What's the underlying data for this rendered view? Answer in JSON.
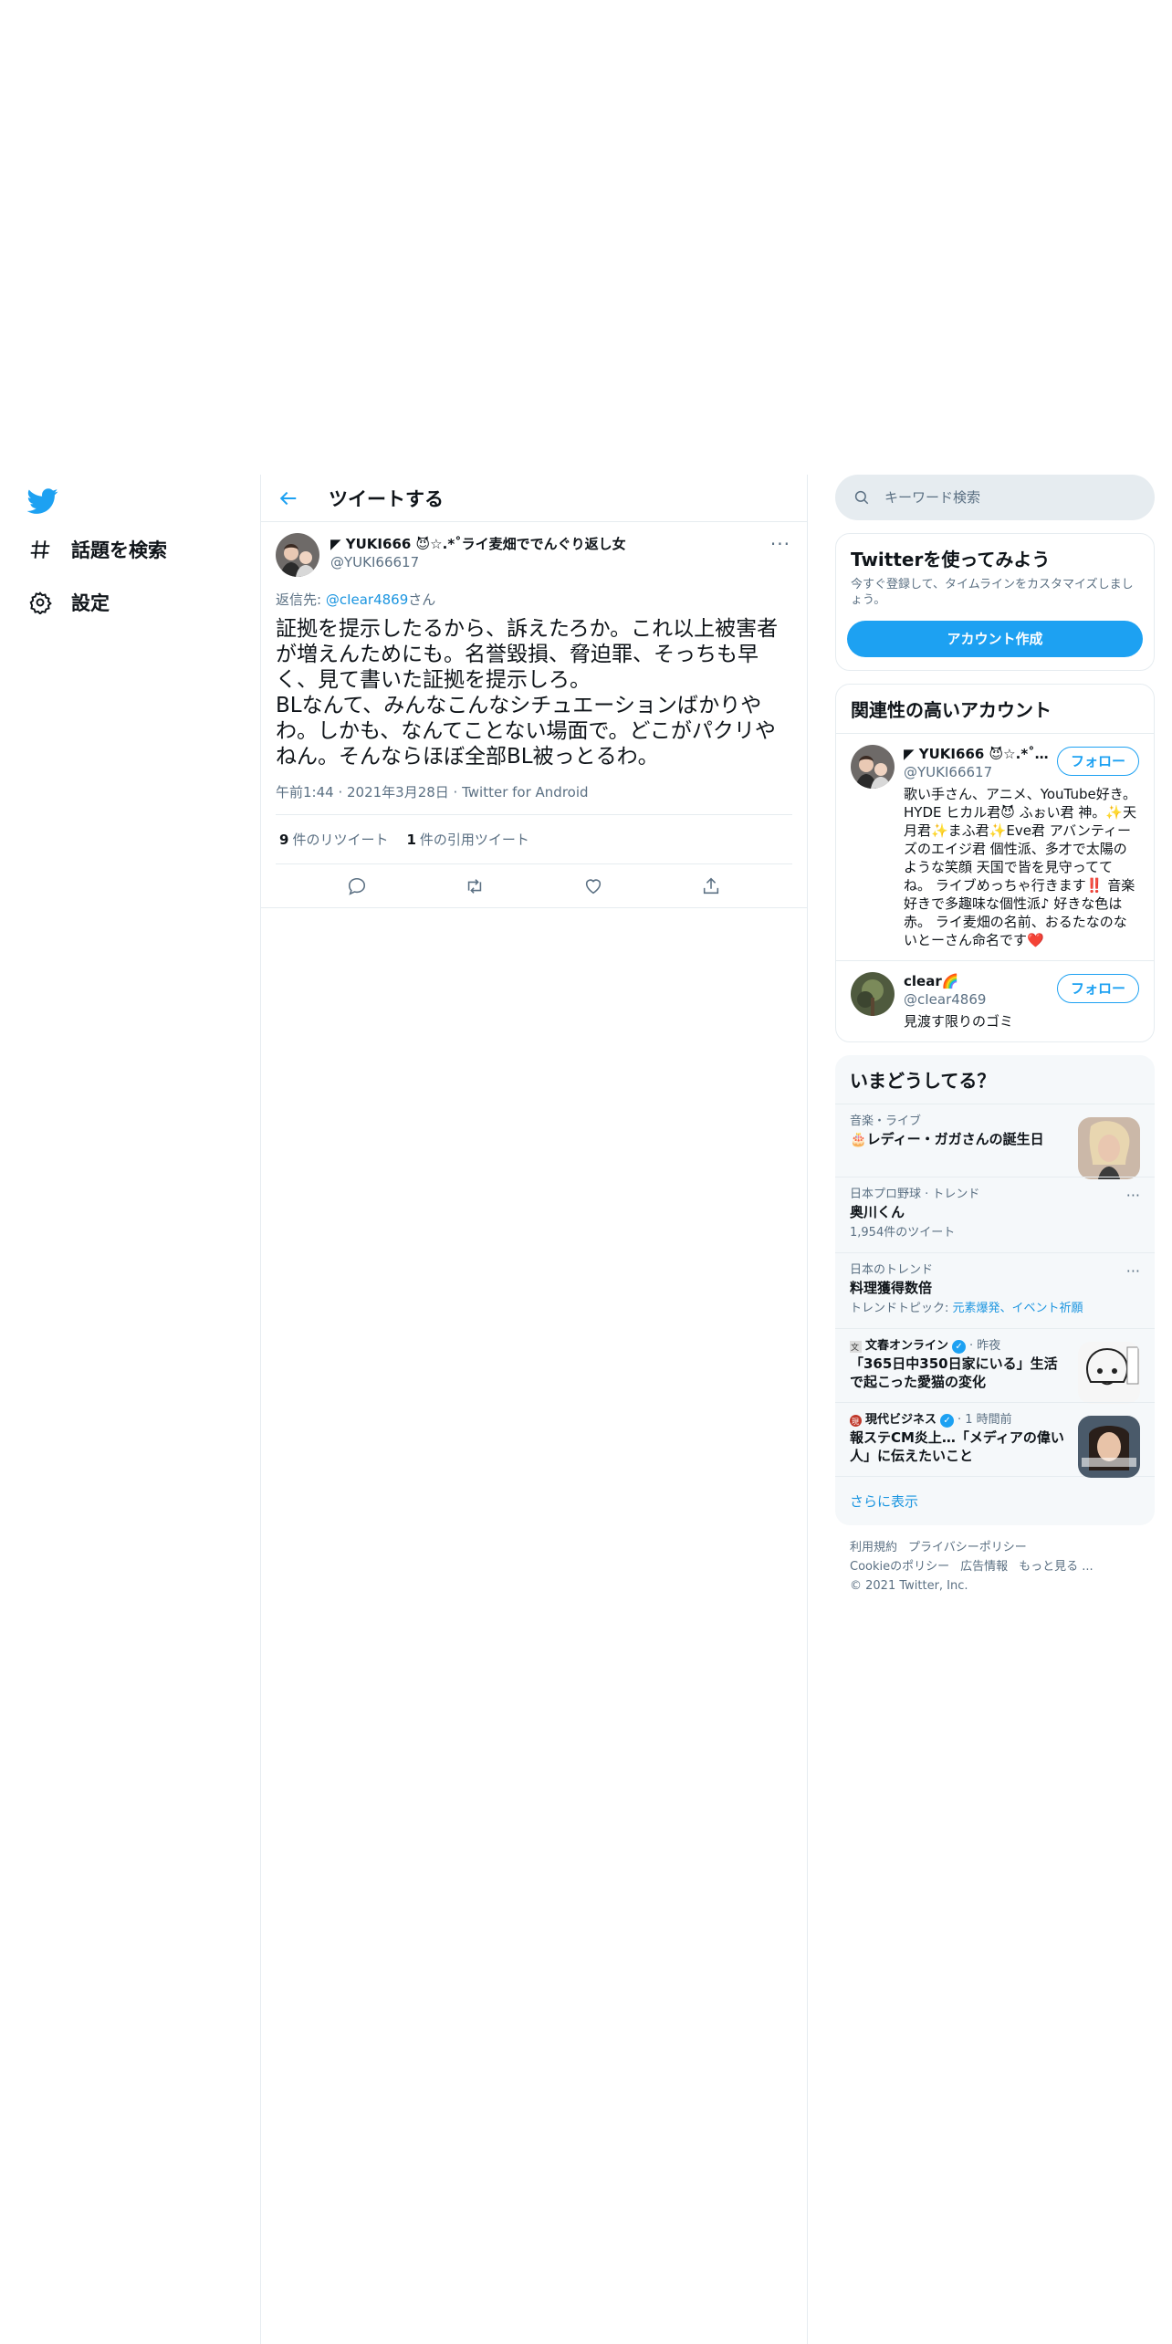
{
  "nav": {
    "items": [
      {
        "label": "話題を検索",
        "icon": "hashtag-icon"
      },
      {
        "label": "設定",
        "icon": "gear-icon"
      }
    ]
  },
  "header": {
    "title": "ツイートする"
  },
  "tweet": {
    "name": "◤ YUKI666 😈☆.*˚ライ麦畑ででんぐり返し女",
    "handle": "@YUKI66617",
    "reply_prefix": "返信先: ",
    "reply_to": "@cIear4869",
    "reply_suffix": "さん",
    "body": "証拠を提示したるから、訴えたろか。これ以上被害者が増えんためにも。名誉毀損、脅迫罪、そっちも早く、見て書いた証拠を提示しろ。\nBLなんて、みんなこんなシチュエーションばかりやわ。しかも、なんてことない場面で。どこがパクリやねん。そんならほぼ全部BL被っとるわ。",
    "meta": "午前1:44 · 2021年3月28日 · Twitter for Android",
    "retweets": "9",
    "retweets_label": "件のリツイート",
    "quotes": "1",
    "quotes_label": "件の引用ツイート",
    "more": "···"
  },
  "search": {
    "placeholder": "キーワード検索"
  },
  "signup": {
    "title": "Twitterを使ってみよう",
    "desc": "今すぐ登録して、タイムラインをカスタマイズしましょう。",
    "button": "アカウント作成"
  },
  "related": {
    "title": "関連性の高いアカウント",
    "accounts": [
      {
        "name": "◤ YUKI666 😈☆.*˚...",
        "handle": "@YUKI66617",
        "bio": "歌い手さん、アニメ、YouTube好き。HYDE ヒカル君😈 ふぉい君 神。✨天月君✨まふ君✨Eve君 アバンティーズのエイジ君 個性派、多才で太陽のような笑顔 天国で皆を見守っててね。 ライブめっちゃ行きます‼️ 音楽好きで多趣味な個性派♪ 好きな色は赤。 ライ麦畑の名前、おるたなのないとーさん命名です❤️",
        "follow": "フォロー"
      },
      {
        "name": "clear🌈",
        "handle": "@cIear4869",
        "bio": "見渡す限りのゴミ",
        "follow": "フォロー"
      }
    ]
  },
  "trends": {
    "title": "いまどうしてる？",
    "items": [
      {
        "category": "音楽・ライブ",
        "title": "🎂レディー・ガガさんの誕生日"
      },
      {
        "category": "日本プロ野球 · トレンド",
        "title": "奥川くん",
        "sub": "1,954件のツイート"
      },
      {
        "category": "日本のトレンド",
        "title": "料理獲得数倍",
        "sub_prefix": "トレンドトピック: ",
        "sub_link": "元素爆発、イベント祈願"
      },
      {
        "source": "文春オンライン",
        "time": " · 昨夜",
        "title": "「365日中350日家にいる」生活で起こった愛猫の変化"
      },
      {
        "source": "現代ビジネス",
        "time": " · 1 時間前",
        "title": "報ステCM炎上…「メディアの偉い人」に伝えたいこと"
      }
    ],
    "show_more": "さらに表示"
  },
  "footer": {
    "links": [
      "利用規約",
      "プライバシーポリシー",
      "Cookieのポリシー",
      "広告情報",
      "もっと見る ..."
    ],
    "copyright": "© 2021 Twitter, Inc."
  },
  "colors": {
    "accent": "#1da1f2",
    "link": "#1b95e0",
    "muted": "#5b7083",
    "border": "#e6ecf0"
  }
}
